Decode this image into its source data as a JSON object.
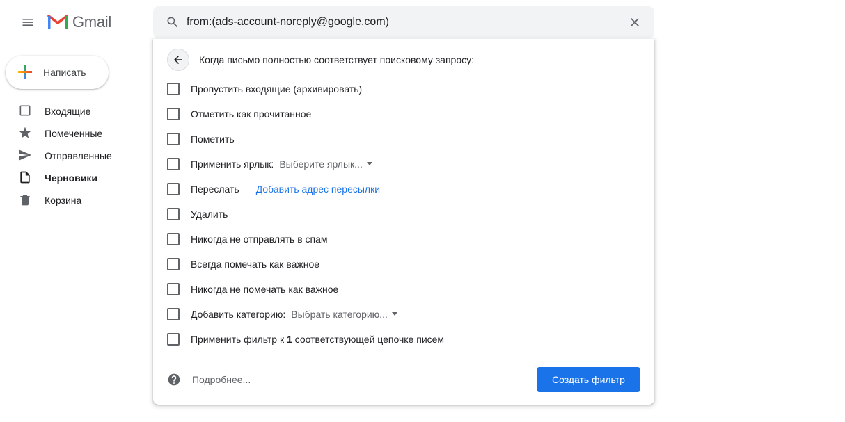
{
  "header": {
    "product": "Gmail",
    "search_value": "from:(ads-account-noreply@google.com)"
  },
  "compose_label": "Написать",
  "nav": [
    {
      "key": "inbox",
      "icon": "inbox",
      "label": "Входящие",
      "active": false
    },
    {
      "key": "starred",
      "icon": "star",
      "label": "Помеченные",
      "active": false
    },
    {
      "key": "sent",
      "icon": "send",
      "label": "Отправленные",
      "active": false
    },
    {
      "key": "drafts",
      "icon": "file",
      "label": "Черновики",
      "active": true
    },
    {
      "key": "trash",
      "icon": "trash",
      "label": "Корзина",
      "active": false
    }
  ],
  "filter": {
    "title": "Когда письмо полностью соответствует поисковому запросу:",
    "options": {
      "skip_inbox": "Пропустить входящие (архивировать)",
      "mark_read": "Отметить как прочитанное",
      "star": "Пометить",
      "apply_label": "Применить ярлык:",
      "apply_label_choose": "Выберите ярлык...",
      "forward": "Переслать",
      "forward_add": "Добавить адрес пересылки",
      "delete": "Удалить",
      "never_spam": "Никогда не отправлять в спам",
      "always_important": "Всегда помечать как важное",
      "never_important": "Никогда не помечать как важное",
      "categorize": "Добавить категорию:",
      "categorize_choose": "Выбрать категорию...",
      "apply_to_match_pre": "Применить фильтр к ",
      "apply_to_match_num": "1",
      "apply_to_match_post": " соответствующей цепочке писем"
    },
    "more": "Подробнее...",
    "create": "Создать фильтр"
  }
}
